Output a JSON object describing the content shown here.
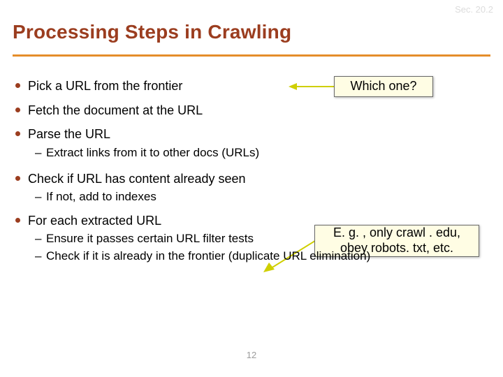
{
  "header": {
    "section_ref": "Sec. 20.2",
    "title": "Processing Steps in Crawling"
  },
  "bullets": {
    "b1": "Pick a URL from the frontier",
    "b2": "Fetch the document at the URL",
    "b3": "Parse the URL",
    "b3_sub1": "Extract links from it to other docs (URLs)",
    "b4": "Check if URL has content already seen",
    "b4_sub1": "If not, add to indexes",
    "b5": "For each extracted URL",
    "b5_sub1": "Ensure it passes certain URL filter tests",
    "b5_sub2": "Check if it is already in the frontier (duplicate URL elimination)"
  },
  "callouts": {
    "c1": "Which one?",
    "c2": "E. g. , only crawl . edu, obey robots. txt, etc."
  },
  "footer": {
    "page_number": "12"
  }
}
